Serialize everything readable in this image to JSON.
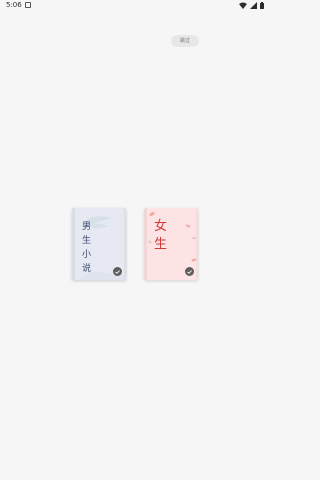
{
  "status_bar": {
    "time": "5:06"
  },
  "skip": {
    "label": "跳过"
  },
  "cards": [
    {
      "title": "男生小说",
      "selected": true
    },
    {
      "title": "女生",
      "selected": true
    }
  ],
  "colors": {
    "background": "#f6f6f6",
    "male_card": "#e6e9f1",
    "male_text": "#3c4a6b",
    "female_card": "#fde3e3",
    "female_text": "#d23a3a",
    "check": "#5d5d5d"
  }
}
